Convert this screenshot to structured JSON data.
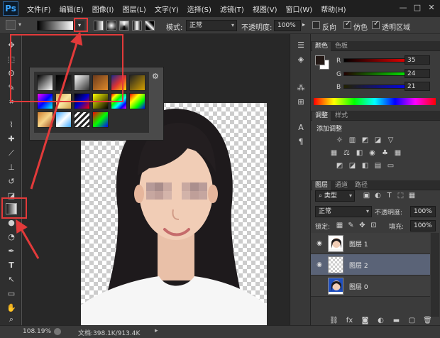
{
  "app": {
    "logo": "Ps"
  },
  "menu": [
    "文件(F)",
    "编辑(E)",
    "图像(I)",
    "图层(L)",
    "文字(Y)",
    "选择(S)",
    "滤镜(T)",
    "视图(V)",
    "窗口(W)",
    "帮助(H)"
  ],
  "window_controls": {
    "minimize": "—",
    "maximize": "□",
    "close": "✕"
  },
  "options": {
    "mode_label": "模式:",
    "mode_value": "正常",
    "opacity_label": "不透明度:",
    "opacity_value": "100%",
    "reverse_label": "反向",
    "dither_label": "仿色",
    "transparency_label": "透明区域",
    "reverse_checked": false,
    "dither_checked": true,
    "transparency_checked": true
  },
  "gradient_picker": {
    "swatches": [
      "linear-gradient(135deg,#000,#fff)",
      "linear-gradient(135deg,#000,rgba(0,0,0,0))",
      "linear-gradient(135deg,#fff,rgba(255,255,255,0))",
      "linear-gradient(135deg,#6b3a1c,#e08a2a)",
      "linear-gradient(135deg,#1d2a8c,#d33,#ffd400)",
      "linear-gradient(135deg,#222,#d3a000)",
      "linear-gradient(135deg,#f0f,#00f,#0ff)",
      "linear-gradient(135deg,#d2a24a,#f9e7a3,#d2a24a)",
      "linear-gradient(135deg,#000,#00c,#f00)",
      "linear-gradient(135deg,#ff0,#000)",
      "linear-gradient(135deg,#f00,#ff0,#0f0,#0ff,#00f,#f0f)",
      "linear-gradient(135deg,#f00,#ff0,#0f0,#00f)",
      "linear-gradient(135deg,#d08030,#f7d58a,#a05020)",
      "linear-gradient(135deg,#3aa7ff,#fff,#3aa7ff)",
      "repeating-linear-gradient(135deg,#222 0 3px,#fff 3px 6px)",
      "linear-gradient(135deg,#f00,#0f0,#00f)",
      "linear-gradient(135deg,#aaa,#fff,#666)",
      "linear-gradient(135deg,#6af,#fc6)",
      "linear-gradient(135deg,#ccc 25%,#fff 25%,#fff 50%,#ccc 50%,#ccc 75%,#fff 75%)"
    ],
    "gear": "⚙"
  },
  "toolbar_tools": [
    {
      "name": "move-tool-icon",
      "glyph": "✥"
    },
    {
      "name": "marquee-tool-icon",
      "glyph": "⬚"
    },
    {
      "name": "lasso-tool-icon",
      "glyph": "ʘ"
    },
    {
      "name": "quick-select-tool-icon",
      "glyph": "✎"
    },
    {
      "name": "crop-tool-icon",
      "glyph": "⌗"
    },
    {
      "name": "eyedropper-tool-icon",
      "glyph": "⌇"
    },
    {
      "name": "healing-brush-tool-icon",
      "glyph": "✚"
    },
    {
      "name": "brush-tool-icon",
      "glyph": "⟋"
    },
    {
      "name": "clone-stamp-tool-icon",
      "glyph": "⊥"
    },
    {
      "name": "history-brush-tool-icon",
      "glyph": "↺"
    },
    {
      "name": "gradient-tool-icon",
      "glyph": "■"
    },
    {
      "name": "blur-tool-icon",
      "glyph": "●"
    },
    {
      "name": "dodge-tool-icon",
      "glyph": "◔"
    },
    {
      "name": "pen-tool-icon",
      "glyph": "✒"
    },
    {
      "name": "type-tool-icon",
      "glyph": "T"
    },
    {
      "name": "path-select-tool-icon",
      "glyph": "↖"
    },
    {
      "name": "rectangle-tool-icon",
      "glyph": "▭"
    },
    {
      "name": "hand-tool-icon",
      "glyph": "✋"
    },
    {
      "name": "zoom-tool-icon",
      "glyph": "⌕"
    }
  ],
  "color_panel": {
    "tab_color": "颜色",
    "tab_swatches": "色板",
    "r_label": "R",
    "g_label": "G",
    "b_label": "B",
    "r_value": "35",
    "g_value": "24",
    "b_value": "21",
    "foreground_color": "#231815",
    "background_color": "#ffffff"
  },
  "adjust_panel": {
    "tab_adjust": "调整",
    "tab_styles": "样式",
    "title": "添加调整"
  },
  "layers_panel": {
    "tab_layers": "图层",
    "tab_channels": "通道",
    "tab_paths": "路径",
    "kind_label": "类型",
    "blend_mode": "正常",
    "opacity_label": "不透明度:",
    "opacity_value": "100%",
    "lock_label": "锁定:",
    "fill_label": "填充:",
    "fill_value": "100%",
    "layers": [
      {
        "name": "图层 1",
        "visible": true,
        "selected": false
      },
      {
        "name": "图层 2",
        "visible": true,
        "selected": true
      },
      {
        "name": "图层 0",
        "visible": false,
        "selected": false
      }
    ]
  },
  "status": {
    "zoom": "108.19%",
    "doc_info": "文档:398.1K/913.4K"
  }
}
